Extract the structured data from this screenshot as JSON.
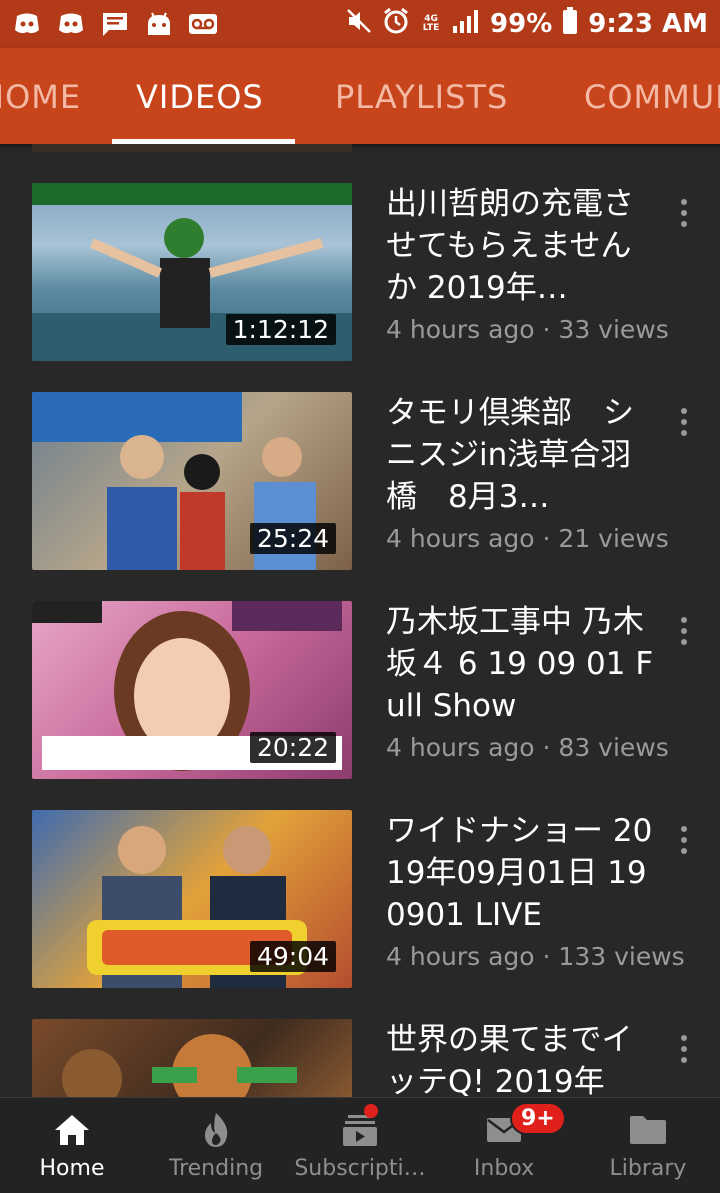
{
  "status_bar": {
    "battery": "99%",
    "time": "9:23 AM",
    "network": "4G LTE",
    "icons": [
      "discord-icon",
      "discord-icon",
      "message-icon",
      "android-icon",
      "voicemail-icon",
      "mute-icon",
      "alarm-icon",
      "signal-icon",
      "battery-icon"
    ]
  },
  "tabs": [
    {
      "label": "HOME"
    },
    {
      "label": "VIDEOS"
    },
    {
      "label": "PLAYLISTS"
    },
    {
      "label": "COMMUNITY"
    }
  ],
  "videos": [
    {
      "title": "出川哲朗の充電させてもらえませんか 2019年…",
      "duration": "1:12:12",
      "meta": "4 hours ago · 33 views"
    },
    {
      "title": "タモリ倶楽部　シニスジin浅草合羽橋　8月3…",
      "duration": "25:24",
      "meta": "4 hours ago · 21 views"
    },
    {
      "title": "乃木坂工事中 乃木坂４ 6 19 09 01 Full Show",
      "duration": "20:22",
      "meta": "4 hours ago · 83 views"
    },
    {
      "title": "ワイドナショー 2019年09月01日 190901 LIVE",
      "duration": "49:04",
      "meta": "4 hours ago · 133 views"
    },
    {
      "title": "世界の果てまでイッテQ! 2019年",
      "duration": "",
      "meta": ""
    }
  ],
  "bottom_nav": {
    "items": [
      {
        "label": "Home",
        "icon": "home-icon"
      },
      {
        "label": "Trending",
        "icon": "flame-icon"
      },
      {
        "label": "Subscripti…",
        "icon": "subscriptions-icon"
      },
      {
        "label": "Inbox",
        "icon": "mail-icon"
      },
      {
        "label": "Library",
        "icon": "folder-icon"
      }
    ],
    "inbox_badge": "9+"
  },
  "colors": {
    "status_bar": "#b33a19",
    "header": "#c8441b",
    "background": "#282828",
    "badge": "#e0201b"
  }
}
